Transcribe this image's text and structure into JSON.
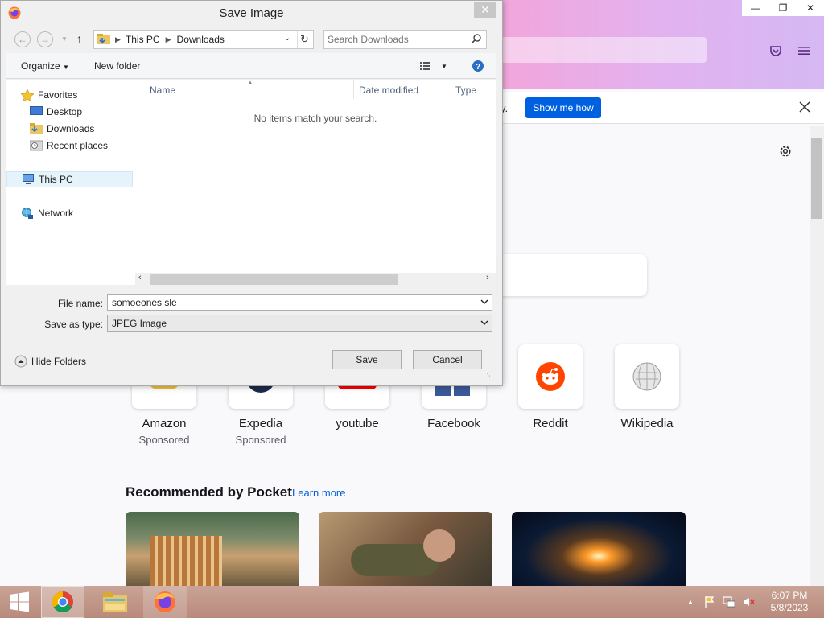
{
  "dialog": {
    "title": "Save Image",
    "breadcrumb": [
      "This PC",
      "Downloads"
    ],
    "search_placeholder": "Search Downloads",
    "toolbar": {
      "organize": "Organize",
      "new_folder": "New folder"
    },
    "nav": {
      "favorites": "Favorites",
      "desktop": "Desktop",
      "downloads": "Downloads",
      "recent_places": "Recent places",
      "this_pc": "This PC",
      "network": "Network"
    },
    "columns": {
      "name": "Name",
      "date_modified": "Date modified",
      "type": "Type"
    },
    "empty_message": "No items match your search.",
    "file_name_label": "File name:",
    "file_name_value": "somoeones sle",
    "save_type_label": "Save as type:",
    "save_type_value": "JPEG Image",
    "hide_folders": "Hide Folders",
    "save_button": "Save",
    "cancel_button": "Cancel"
  },
  "browser": {
    "notification_text": "y.",
    "show_me_how": "Show me how",
    "top_sites": [
      {
        "label": "Amazon",
        "sub": "Sponsored"
      },
      {
        "label": "Expedia",
        "sub": "Sponsored"
      },
      {
        "label": "youtube",
        "sub": ""
      },
      {
        "label": "Facebook",
        "sub": ""
      },
      {
        "label": "Reddit",
        "sub": ""
      },
      {
        "label": "Wikipedia",
        "sub": ""
      }
    ],
    "pocket_title": "Recommended by Pocket",
    "pocket_link": "Learn more"
  },
  "taskbar": {
    "time": "6:07 PM",
    "date": "5/8/2023"
  },
  "colors": {
    "accent_blue": "#0061e0",
    "taskbar": "#b88a7c",
    "reddit": "#ff4500"
  }
}
